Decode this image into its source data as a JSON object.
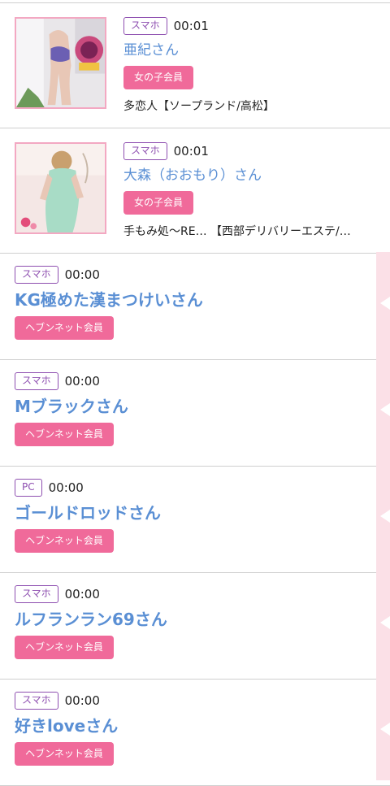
{
  "items": [
    {
      "device": "スマホ",
      "time": "00:01",
      "name": "亜紀さん",
      "badge": "女の子会員",
      "shop": "多恋人【ソープランド/高松】"
    },
    {
      "device": "スマホ",
      "time": "00:01",
      "name": "大森（おおもり）さん",
      "badge": "女の子会員",
      "shop": "手もみ処～RE… 【西部デリバリーエステ/…"
    },
    {
      "device": "スマホ",
      "time": "00:00",
      "name": "KG極めた漢まつけいさん",
      "badge": "ヘブンネット会員"
    },
    {
      "device": "スマホ",
      "time": "00:00",
      "name": "Mブラックさん",
      "badge": "ヘブンネット会員"
    },
    {
      "device": "PC",
      "time": "00:00",
      "name": "ゴールドロッドさん",
      "badge": "ヘブンネット会員"
    },
    {
      "device": "スマホ",
      "time": "00:00",
      "name": "ルフランラン69さん",
      "badge": "ヘブンネット会員"
    },
    {
      "device": "スマホ",
      "time": "00:00",
      "name": "好きloveさん",
      "badge": "ヘブンネット会員"
    }
  ],
  "colors": {
    "name": "#5a8fd4",
    "badge": "#f06a9a",
    "device_border": "#8e4fb0",
    "thumb_border": "#f3a8c2",
    "sidebar": "#fbe0e7"
  }
}
